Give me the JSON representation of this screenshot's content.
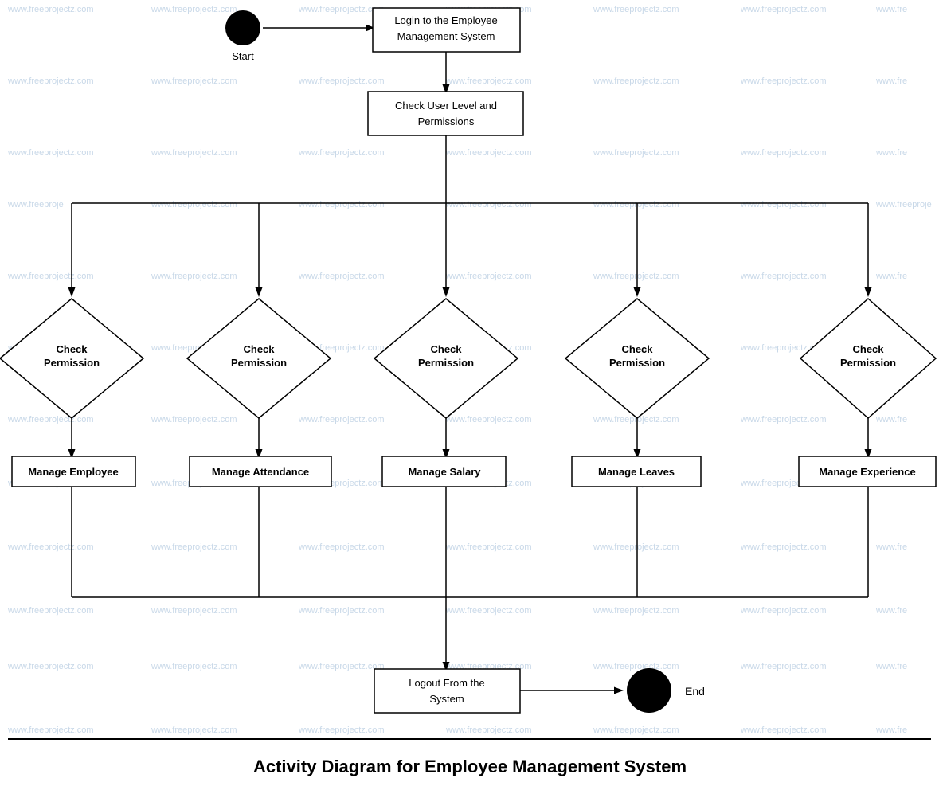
{
  "watermark": {
    "text": "www.freeprojectz.com"
  },
  "diagram": {
    "title": "Activity Diagram for Employee Management System",
    "nodes": {
      "start_label": "Start",
      "login": "Login to the Employee\nManagement System",
      "check_user_level": "Check User Level and\nPermissions",
      "check_permission_1": "Check\nPermission",
      "check_permission_2": "Check\nPermission",
      "check_permission_3": "Check\nPermission",
      "check_permission_4": "Check\nPermission",
      "check_permission_5": "Check\nPermission",
      "manage_employee": "Manage Employee",
      "manage_attendance": "Manage Attendance",
      "manage_salary": "Manage Salary",
      "manage_leaves": "Manage Leaves",
      "manage_experience": "Manage Experience",
      "logout": "Logout From the\nSystem",
      "end_label": "End"
    }
  }
}
